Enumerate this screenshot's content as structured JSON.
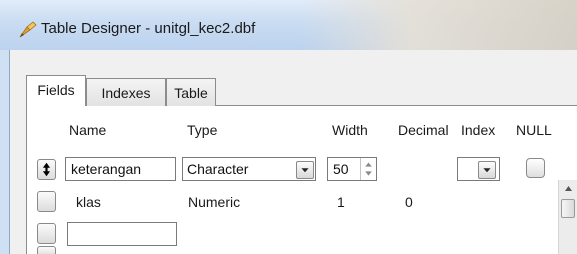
{
  "window": {
    "title": "Table Designer - unitgl_kec2.dbf"
  },
  "tabs": {
    "fields": "Fields",
    "indexes": "Indexes",
    "table": "Table"
  },
  "columns": {
    "name": "Name",
    "type": "Type",
    "width": "Width",
    "decimal": "Decimal",
    "index": "Index",
    "null": "NULL"
  },
  "rows": [
    {
      "name": "keterangan",
      "type": "Character",
      "width": "50",
      "decimal": "",
      "selected": true
    },
    {
      "name": "klas",
      "type": "Numeric",
      "width": "1",
      "decimal": "0"
    },
    {
      "name": "",
      "type": "",
      "width": "",
      "decimal": ""
    }
  ]
}
